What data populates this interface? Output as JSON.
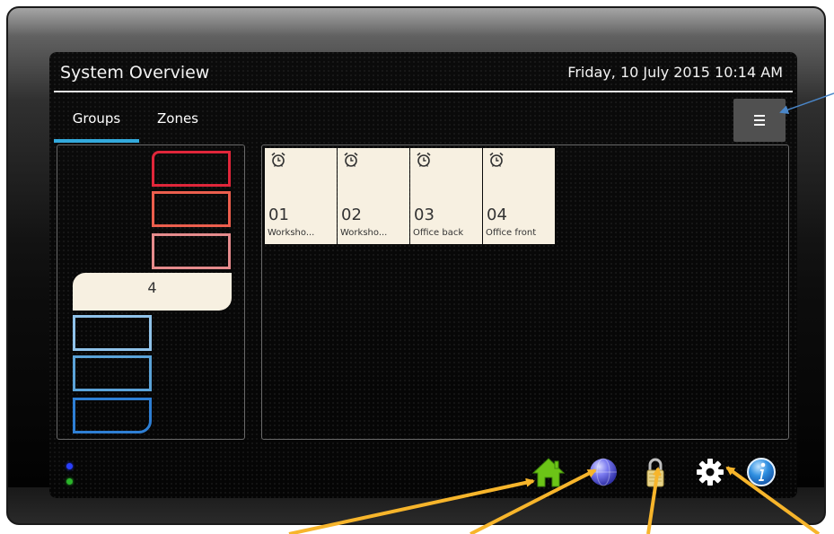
{
  "header": {
    "title": "System Overview",
    "datetime": "Friday, 10 July 2015 10:14 AM"
  },
  "tabs": [
    {
      "label": "Groups",
      "active": true
    },
    {
      "label": "Zones",
      "active": false
    }
  ],
  "menu_button": {
    "icon": "menu-icon"
  },
  "groups": {
    "items": [
      {
        "label": "",
        "color": "#e0263a"
      },
      {
        "label": "",
        "color": "#ec5e4d"
      },
      {
        "label": "",
        "color": "#e58b8c"
      },
      {
        "label": "4",
        "color": "#f7f0e1",
        "selected": true
      },
      {
        "label": "",
        "color": "#90c3ea"
      },
      {
        "label": "",
        "color": "#5ba3d8"
      },
      {
        "label": "",
        "color": "#2e7fd4"
      }
    ]
  },
  "zones": [
    {
      "number": "01",
      "name": "Worksho...",
      "icon": "alarm-clock-icon"
    },
    {
      "number": "02",
      "name": "Worksho...",
      "icon": "alarm-clock-icon"
    },
    {
      "number": "03",
      "name": "Office back",
      "icon": "alarm-clock-icon"
    },
    {
      "number": "04",
      "name": "Office front",
      "icon": "alarm-clock-icon"
    }
  ],
  "statusbar": {
    "leds": [
      {
        "icon": "status-led-blue",
        "color": "#2a3fff"
      },
      {
        "icon": "status-led-green",
        "color": "#2ab42a"
      }
    ],
    "nav": [
      {
        "icon": "home-icon",
        "color": "#6cc417"
      },
      {
        "icon": "globe-icon",
        "color": "#6a6ae8"
      },
      {
        "icon": "lock-icon",
        "color": "#e8d48a"
      },
      {
        "icon": "gear-icon",
        "color": "#ffffff"
      },
      {
        "icon": "info-icon",
        "color": "#2f8fe0"
      }
    ]
  },
  "colors": {
    "accent": "#33aadd",
    "annotation_arrow_orange": "#f7b52b",
    "annotation_arrow_blue": "#4a86c8",
    "tile_background": "#f7f0e1"
  }
}
